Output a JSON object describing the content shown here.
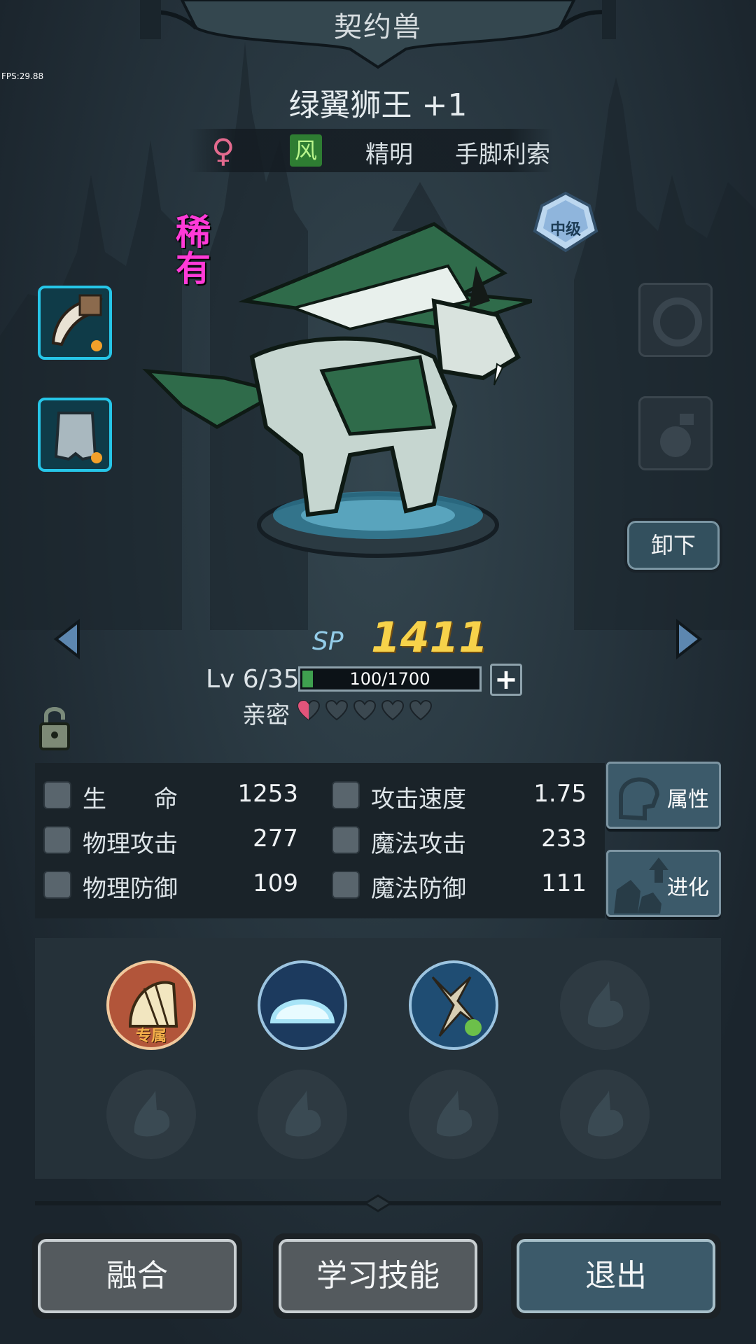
{
  "fps": "FPS:29.88",
  "header": {
    "title": "契约兽"
  },
  "pet": {
    "name": "绿翼狮王 +1",
    "gender": "♀",
    "element": "风",
    "traits": [
      "精明",
      "手脚利索"
    ],
    "rarity": "稀有",
    "grade": "中级"
  },
  "equip": {
    "unequip_label": "卸下"
  },
  "sp": {
    "label": "SP",
    "value": "1411"
  },
  "level": {
    "text": "Lv 6/35",
    "xp_text": "100/1700",
    "xp_fraction": 0.059,
    "plus": "+"
  },
  "intimacy": {
    "label": "亲密",
    "filled": 0.5,
    "total": 5
  },
  "stats": [
    {
      "label": "生　　命",
      "value": "1253",
      "icon": "heart-icon"
    },
    {
      "label": "攻击速度",
      "value": "1.75",
      "icon": "attack-speed-icon"
    },
    {
      "label": "物理攻击",
      "value": "277",
      "icon": "sword-icon"
    },
    {
      "label": "魔法攻击",
      "value": "233",
      "icon": "staff-icon"
    },
    {
      "label": "物理防御",
      "value": "109",
      "icon": "shield-icon"
    },
    {
      "label": "魔法防御",
      "value": "111",
      "icon": "cross-icon"
    }
  ],
  "side_buttons": {
    "attributes": "属性",
    "evolve": "进化"
  },
  "skills": {
    "exclusive_tag": "专属"
  },
  "buttons": {
    "fuse": "融合",
    "learn": "学习技能",
    "exit": "退出"
  },
  "colors": {
    "rarity": "#ff3ad8",
    "sp": "#f7d24a",
    "accent": "#26c6e8"
  }
}
